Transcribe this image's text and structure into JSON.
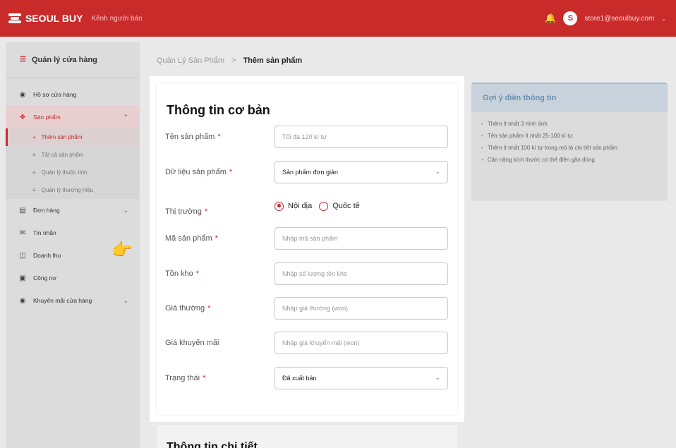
{
  "topbar": {
    "brand": "SEOUL BUY",
    "channel": "Kênh người bán",
    "avatar_letter": "S",
    "account_email": "store1@seoulbuy.com",
    "bell_icon": "bell-icon",
    "dropdown_icon": "chevron-down-icon"
  },
  "sidebar": {
    "header": "Quản lý cửa hàng",
    "items": [
      {
        "label": "Hồ sơ cửa hàng",
        "icon": "store-icon"
      },
      {
        "label": "Sản phẩm",
        "icon": "product-icon",
        "active": true,
        "expanded": true
      },
      {
        "label": "Đơn hàng",
        "icon": "order-icon"
      },
      {
        "label": "Tin nhắn",
        "icon": "message-icon"
      },
      {
        "label": "Doanh thu",
        "icon": "revenue-icon"
      },
      {
        "label": "Công nợ",
        "icon": "debt-icon"
      },
      {
        "label": "Khuyến mãi cửa hàng",
        "icon": "promotion-icon"
      }
    ],
    "sub_items": [
      {
        "label": "Thêm sản phẩm",
        "active": true
      },
      {
        "label": "Tất cả sản phẩm"
      },
      {
        "label": "Quản lý thuộc tính"
      },
      {
        "label": "Quản lý thương hiệu"
      }
    ]
  },
  "breadcrumb": {
    "parent": "Quản Lý Sản Phẩm",
    "separator": ">",
    "current": "Thêm sản phẩm"
  },
  "form": {
    "title": "Thông tin cơ bản",
    "required_mark": "*",
    "name": {
      "label": "Tên sản phẩm",
      "placeholder": "Tối đa 120 kí tự"
    },
    "data_type": {
      "label": "Dữ liệu sản phẩm",
      "value": "Sản phẩm đơn giản"
    },
    "market": {
      "label": "Thị trường",
      "options": [
        "Nội địa",
        "Quốc tế"
      ],
      "selected": "Nội địa"
    },
    "code": {
      "label": "Mã sản phẩm",
      "placeholder": "Nhập mã sản phẩm"
    },
    "stock": {
      "label": "Tồn kho",
      "placeholder": "Nhập số lượng tồn kho"
    },
    "price": {
      "label": "Giá thường",
      "placeholder": "Nhập giá thường (won)"
    },
    "sale_price": {
      "label": "Giá khuyến mãi",
      "placeholder": "Nhập giá khuyến mãi (won)"
    },
    "status": {
      "label": "Trạng thái",
      "value": "Đã xuất bản"
    }
  },
  "detail_section": {
    "title": "Thông tin chi tiết"
  },
  "hints": {
    "title": "Gợi ý điền thông tin",
    "items": [
      "Thêm ít nhất 3 hình ảnh",
      "Tên sản phẩm ít nhất 25-100 kí tự",
      "Thêm ít nhất 100 kí tự trong mô tả chi tiết sản phẩm",
      "Cân nặng kích thước có thể điền gần đúng"
    ]
  },
  "colors": {
    "brand": "#c92a2a",
    "required": "#d0262e",
    "hint_title": "#6a8fb0"
  }
}
